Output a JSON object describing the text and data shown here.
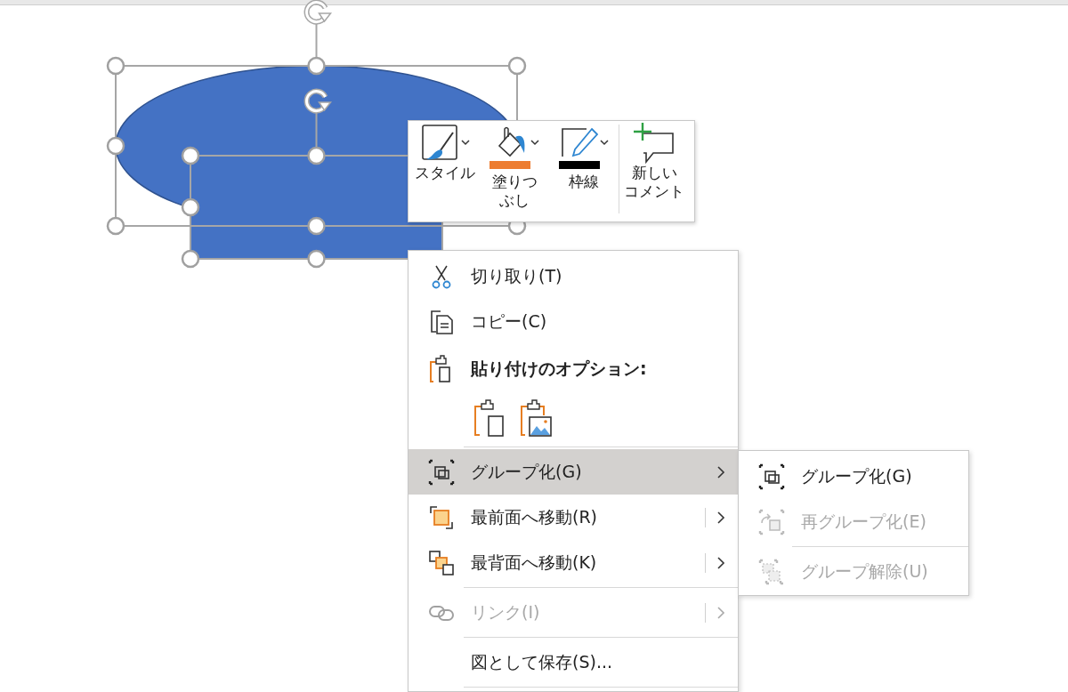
{
  "canvas": {
    "shapes": [
      {
        "kind": "ellipse",
        "selected": true
      },
      {
        "kind": "rectangle",
        "selected": true
      }
    ]
  },
  "mini_toolbar": {
    "buttons": [
      {
        "kind": "style",
        "label_lines": [
          "スタイル"
        ],
        "dropdown": true
      },
      {
        "kind": "fill",
        "label_lines": [
          "塗りつ",
          "ぶし"
        ],
        "dropdown": true,
        "color": "#ed7d31"
      },
      {
        "kind": "outline",
        "label_lines": [
          "枠線"
        ],
        "dropdown": true,
        "color": "#000000"
      },
      {
        "kind": "comment",
        "label_lines": [
          "新しい",
          "コメント"
        ],
        "dropdown": false
      }
    ]
  },
  "context_menu": {
    "items": [
      {
        "kind": "item",
        "label": "切り取り(T)",
        "disabled": false,
        "selected": false
      },
      {
        "kind": "item",
        "label": "コピー(C)",
        "disabled": false,
        "selected": false
      },
      {
        "kind": "header",
        "label": "貼り付けのオプション:"
      },
      {
        "kind": "paste_options"
      },
      {
        "kind": "separator"
      },
      {
        "kind": "item",
        "label": "グループ化(G)",
        "disabled": false,
        "selected": true,
        "submenu": true
      },
      {
        "kind": "item",
        "label": "最前面へ移動(R)",
        "disabled": false,
        "selected": false,
        "submenu": true,
        "split": true
      },
      {
        "kind": "item",
        "label": "最背面へ移動(K)",
        "disabled": false,
        "selected": false,
        "submenu": true,
        "split": true
      },
      {
        "kind": "separator"
      },
      {
        "kind": "item",
        "label": "リンク(I)",
        "disabled": true,
        "selected": false,
        "submenu": true,
        "split": true
      },
      {
        "kind": "separator"
      },
      {
        "kind": "item",
        "label": "図として保存(S)...",
        "disabled": false,
        "selected": false
      },
      {
        "kind": "separator"
      }
    ]
  },
  "submenu": {
    "items": [
      {
        "kind": "item",
        "label": "グループ化(G)",
        "disabled": false
      },
      {
        "kind": "item",
        "label": "再グループ化(E)",
        "disabled": true
      },
      {
        "kind": "separator"
      },
      {
        "kind": "item",
        "label": "グループ解除(U)",
        "disabled": true
      }
    ]
  }
}
